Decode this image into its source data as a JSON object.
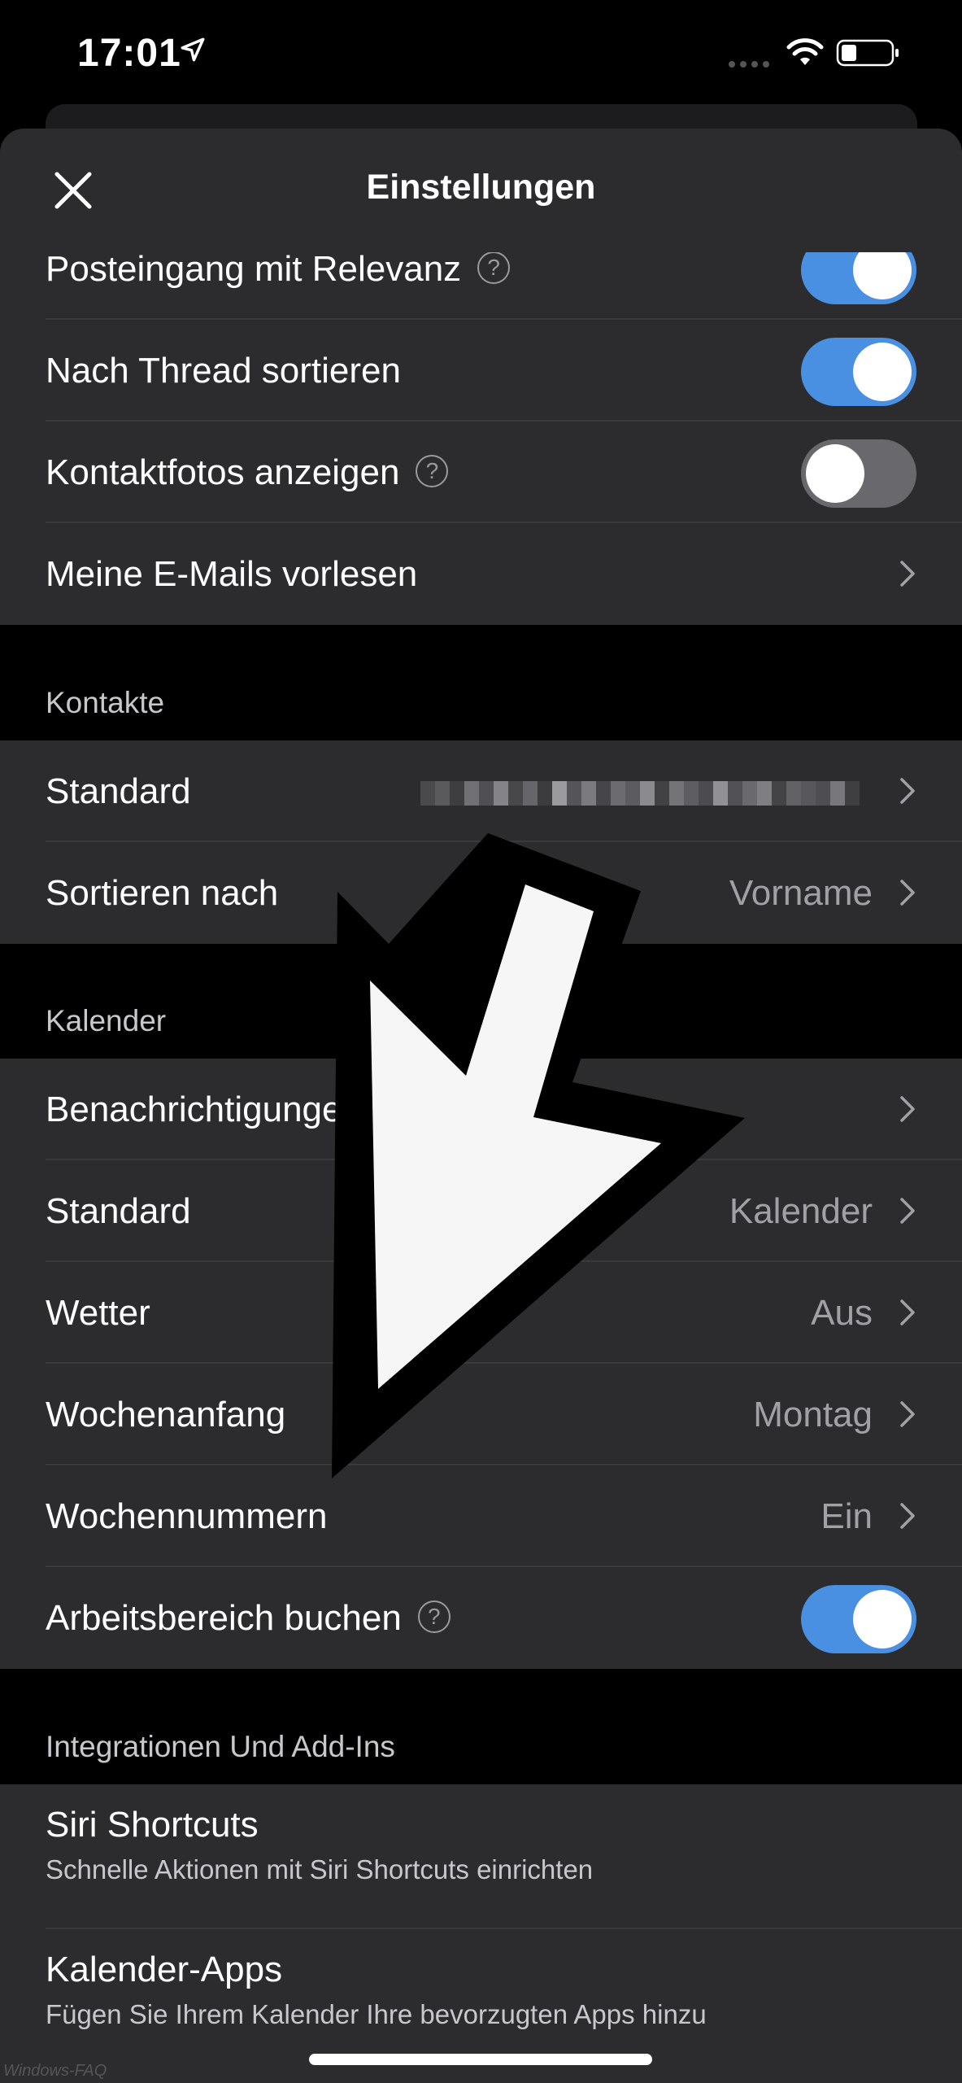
{
  "status_bar": {
    "time": "17:01"
  },
  "header": {
    "title": "Einstellungen"
  },
  "mail_section": {
    "rows": [
      {
        "label": "Posteingang mit Relevanz",
        "help": "?",
        "toggle": "on"
      },
      {
        "label": "Nach Thread sortieren",
        "toggle": "on"
      },
      {
        "label": "Kontaktfotos anzeigen",
        "help": "?",
        "toggle": "off"
      },
      {
        "label": "Meine E-Mails vorlesen"
      }
    ]
  },
  "contacts_section": {
    "header": "Kontakte",
    "rows": [
      {
        "label": "Standard",
        "value_redacted": true
      },
      {
        "label": "Sortieren nach",
        "value": "Vorname"
      }
    ]
  },
  "calendar_section": {
    "header": "Kalender",
    "rows": [
      {
        "label": "Benachrichtigungen"
      },
      {
        "label": "Standard",
        "value": "Kalender"
      },
      {
        "label": "Wetter",
        "value": "Aus"
      },
      {
        "label": "Wochenanfang",
        "value": "Montag"
      },
      {
        "label": "Wochennummern",
        "value": "Ein"
      },
      {
        "label": "Arbeitsbereich buchen",
        "help": "?",
        "toggle": "on"
      }
    ]
  },
  "integrations_section": {
    "header": "Integrationen Und Add-Ins",
    "rows": [
      {
        "label": "Siri Shortcuts",
        "sublabel": "Schnelle Aktionen mit Siri Shortcuts einrichten"
      },
      {
        "label": "Kalender-Apps",
        "sublabel": "Fügen Sie Ihrem Kalender Ihre bevorzugten Apps hinzu"
      }
    ]
  },
  "watermark": "Windows-FAQ",
  "colors": {
    "toggle_on": "#4a90e2",
    "toggle_off": "#68686d",
    "row_bg": "#2c2c2e",
    "background": "#000000"
  }
}
